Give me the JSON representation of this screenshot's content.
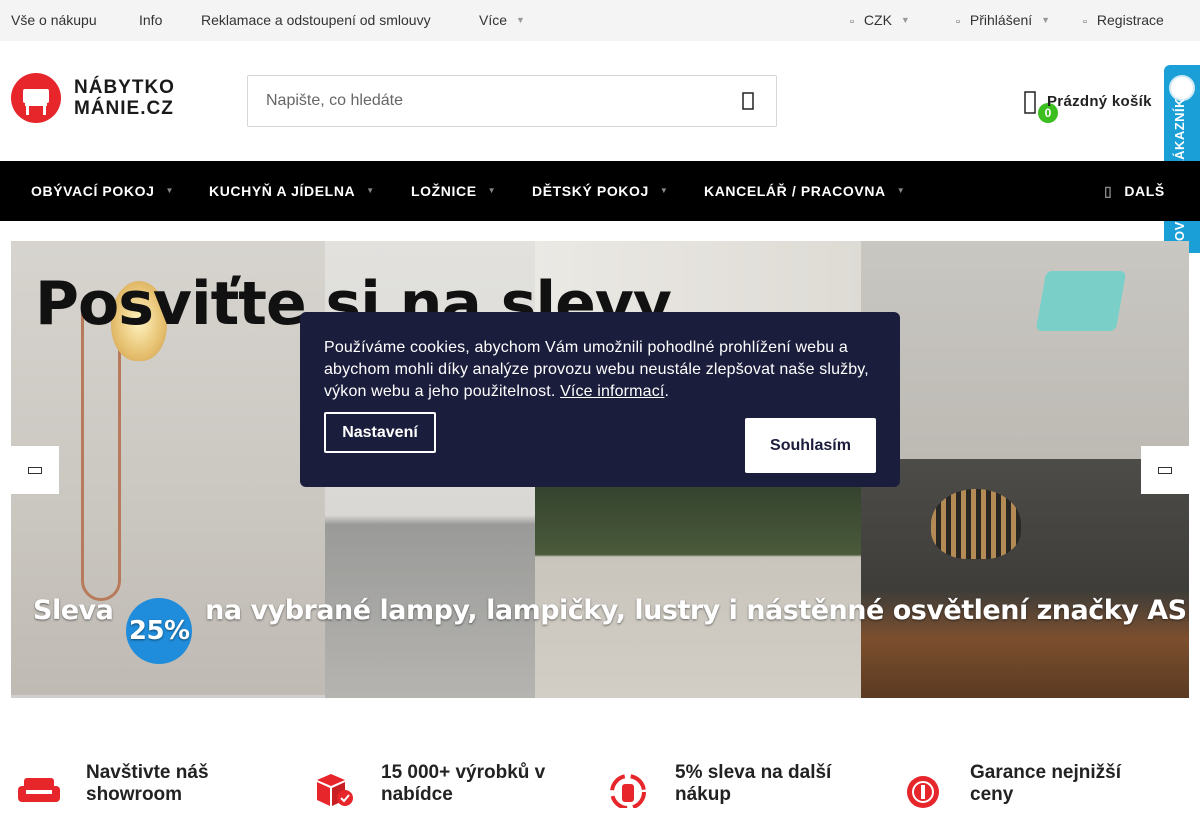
{
  "topbar": {
    "links": [
      "Vše o nákupu",
      "Info",
      "Reklamace a odstoupení od smlouvy",
      "Více"
    ],
    "currency": "CZK",
    "login": "Přihlášení",
    "register": "Registrace"
  },
  "header": {
    "logo_line1": "NÁBYTKO",
    "logo_line2": "MÁNIE.CZ",
    "search_placeholder": "Napište, co hledáte",
    "cart_count": "0",
    "cart_label": "Prázdný košík"
  },
  "badge": {
    "text": "OVĚŘENO ZÁKAZNÍKY"
  },
  "nav": {
    "items": [
      "OBÝVACÍ POKOJ",
      "KUCHYŇ A JÍDELNA",
      "LOŽNICE",
      "DĚTSKÝ POKOJ",
      "KANCELÁŘ / PRACOVNA"
    ],
    "more": "DALŠ"
  },
  "hero": {
    "title": "Posviťte si na slevy",
    "sub_before": "Sleva",
    "sub_pct": "25%",
    "sub_after": "na vybrané lampy, lampičky, lustry i nástěnné osvětlení značky ASIR"
  },
  "cookie": {
    "text": "Používáme cookies, abychom Vám umožnili pohodlné prohlížení webu a abychom mohli díky analýze provozu webu neustále zlepšovat naše služby, výkon webu a jeho použitelnost.",
    "link": "Více informací",
    "settings_label": "Nastavení",
    "agree_label": "Souhlasím"
  },
  "benefits": [
    {
      "text": "Navštivte náš showroom",
      "icon": "sofa-icon"
    },
    {
      "text": "15 000+ výrobků v nabídce",
      "icon": "boxes-icon"
    },
    {
      "text": "5% sleva na další nákup",
      "icon": "discount-icon"
    },
    {
      "text": "Garance nejnižší ceny",
      "icon": "price-badge-icon"
    }
  ],
  "colors": {
    "accent_red": "#e6262b",
    "cart_green": "#3cbd20",
    "cookie_bg": "#1b1d3c",
    "badge_blue": "#1a9fd6"
  }
}
